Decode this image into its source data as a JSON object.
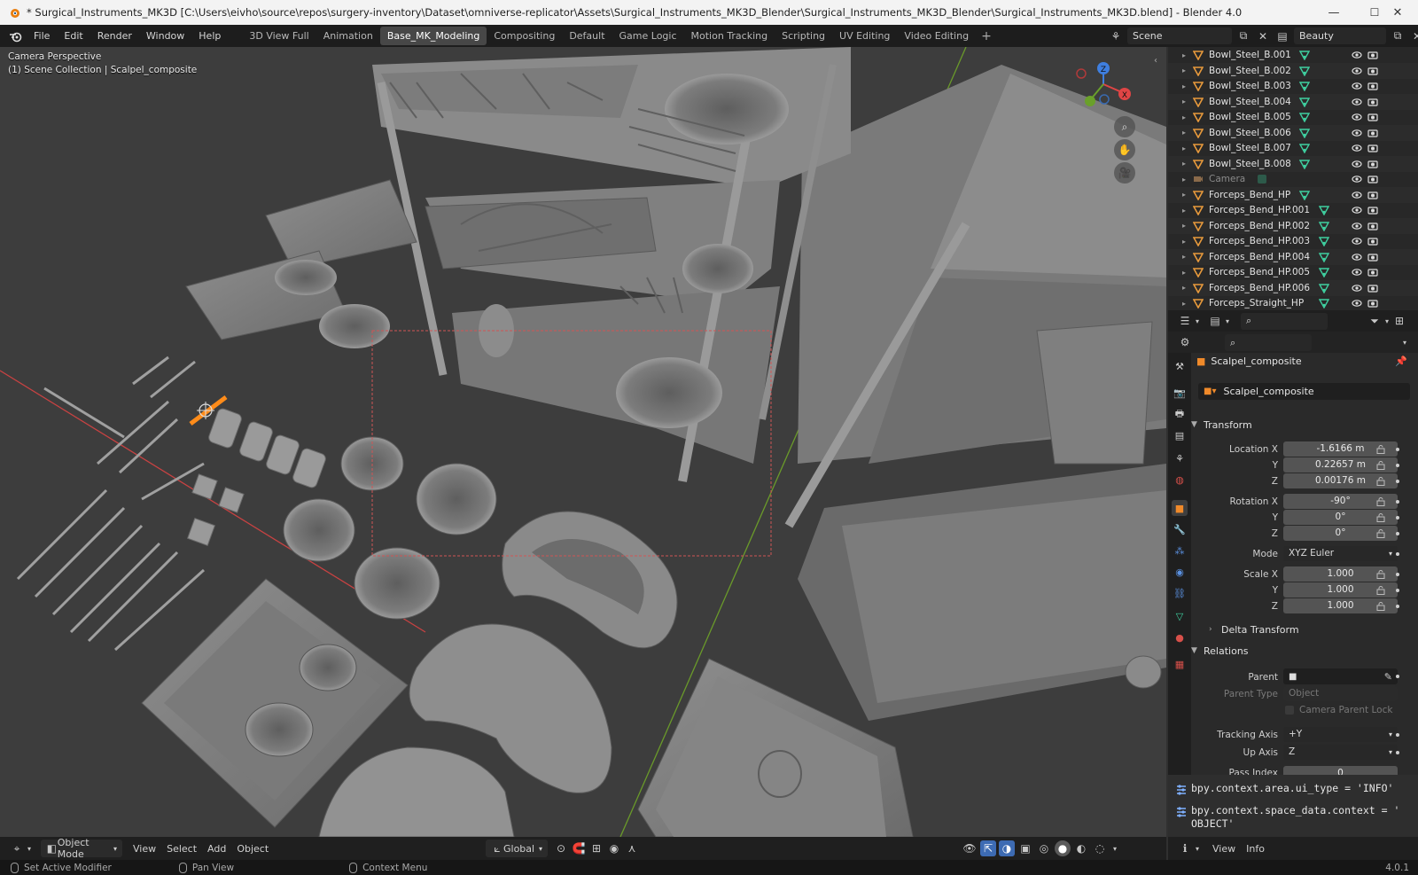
{
  "window": {
    "title": "* Surgical_Instruments_MK3D [C:\\Users\\eivho\\source\\repos\\surgery-inventory\\Dataset\\omniverse-replicator\\Assets\\Surgical_Instruments_MK3D_Blender\\Surgical_Instruments_MK3D_Blender\\Surgical_Instruments_MK3D.blend] - Blender 4.0",
    "minimize": "—",
    "maximize": "☐",
    "close": "✕"
  },
  "menu": [
    "File",
    "Edit",
    "Render",
    "Window",
    "Help"
  ],
  "workspaces": [
    "3D View Full",
    "Animation",
    "Base_MK_Modeling",
    "Compositing",
    "Default",
    "Game Logic",
    "Motion Tracking",
    "Scripting",
    "UV Editing",
    "Video Editing"
  ],
  "active_workspace": "Base_MK_Modeling",
  "workspace_add": "+",
  "scene_selector": "Scene",
  "view_layer": "Beauty",
  "viewport": {
    "perspective": "Camera Perspective",
    "collection": "(1) Scene Collection | Scalpel_composite",
    "gizmo": {
      "z": "Z",
      "x": "X",
      "y": "Y"
    }
  },
  "outliner": [
    {
      "name": "Bowl_Steel_B.001",
      "type": "mesh"
    },
    {
      "name": "Bowl_Steel_B.002",
      "type": "mesh"
    },
    {
      "name": "Bowl_Steel_B.003",
      "type": "mesh"
    },
    {
      "name": "Bowl_Steel_B.004",
      "type": "mesh"
    },
    {
      "name": "Bowl_Steel_B.005",
      "type": "mesh"
    },
    {
      "name": "Bowl_Steel_B.006",
      "type": "mesh"
    },
    {
      "name": "Bowl_Steel_B.007",
      "type": "mesh"
    },
    {
      "name": "Bowl_Steel_B.008",
      "type": "mesh"
    },
    {
      "name": "Camera",
      "type": "camera"
    },
    {
      "name": "Forceps_Bend_HP",
      "type": "mesh"
    },
    {
      "name": "Forceps_Bend_HP.001",
      "type": "mesh"
    },
    {
      "name": "Forceps_Bend_HP.002",
      "type": "mesh"
    },
    {
      "name": "Forceps_Bend_HP.003",
      "type": "mesh"
    },
    {
      "name": "Forceps_Bend_HP.004",
      "type": "mesh"
    },
    {
      "name": "Forceps_Bend_HP.005",
      "type": "mesh"
    },
    {
      "name": "Forceps_Bend_HP.006",
      "type": "mesh"
    },
    {
      "name": "Forceps_Straight_HP",
      "type": "mesh"
    }
  ],
  "properties": {
    "object_name": "Scalpel_composite",
    "object_field": "Scalpel_composite",
    "transform_label": "Transform",
    "location_label": "Location X",
    "location": {
      "x": "-1.6166 m",
      "y": "0.22657 m",
      "z": "0.00176 m"
    },
    "rotation_label": "Rotation X",
    "rotation": {
      "x": "-90°",
      "y": "0°",
      "z": "0°"
    },
    "axis_y": "Y",
    "axis_z": "Z",
    "mode_label": "Mode",
    "mode_value": "XYZ Euler",
    "scale_label": "Scale X",
    "scale": {
      "x": "1.000",
      "y": "1.000",
      "z": "1.000"
    },
    "delta_transform": "Delta Transform",
    "relations_label": "Relations",
    "parent_label": "Parent",
    "parent_type_label": "Parent Type",
    "parent_type_value": "Object",
    "camera_parent_lock": "Camera Parent Lock",
    "tracking_axis_label": "Tracking Axis",
    "tracking_axis_value": "+Y",
    "up_axis_label": "Up Axis",
    "up_axis_value": "Z",
    "pass_index_label": "Pass Index",
    "pass_index_value": "0"
  },
  "console": [
    "bpy.context.area.ui_type = 'INFO'",
    "bpy.context.space_data.context = '",
    "OBJECT'"
  ],
  "viewport_header": {
    "mode": "Object Mode",
    "menus": [
      "View",
      "Select",
      "Add",
      "Object"
    ],
    "orientation": "Global"
  },
  "info_header": {
    "menus": [
      "View",
      "Info"
    ]
  },
  "status": {
    "left": "Set Active Modifier",
    "middle": "Pan View",
    "right": "Context Menu",
    "version": "4.0.1"
  },
  "colors": {
    "accent_selected": "#ff8c1a",
    "x_axis": "#c84242",
    "y_axis": "#6a9a2a",
    "active_tab": "#474747",
    "mesh_icon": "#3fd0a0",
    "object_icon": "#e89a3c"
  }
}
